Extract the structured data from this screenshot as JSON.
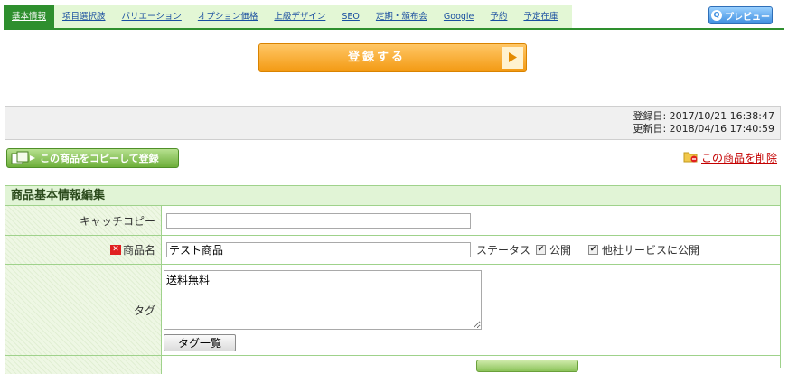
{
  "tabs": [
    {
      "label": "基本情報",
      "active": true
    },
    {
      "label": "項目選択肢",
      "active": false
    },
    {
      "label": "バリエーション",
      "active": false
    },
    {
      "label": "オプション価格",
      "active": false
    },
    {
      "label": "上級デザイン",
      "active": false
    },
    {
      "label": "SEO",
      "active": false
    },
    {
      "label": "定期・頒布会",
      "active": false
    },
    {
      "label": "Google",
      "active": false
    },
    {
      "label": "予約",
      "active": false
    },
    {
      "label": "予定在庫",
      "active": false
    }
  ],
  "preview_label": "プレビュー",
  "register_label": "登録する",
  "dates": {
    "registered": "登録日: 2017/10/21 16:38:47",
    "updated": "更新日: 2018/04/16 17:40:59"
  },
  "copy_label": "この商品をコピーして登録",
  "delete_label": "この商品を削除",
  "section_title": "商品基本情報編集",
  "form": {
    "catchcopy_label": "キャッチコピー",
    "catchcopy_value": "",
    "name_label": "商品名",
    "name_value": "テスト商品",
    "status_label": "ステータス",
    "public_label": "公開",
    "public_checked": true,
    "other_service_label": "他社サービスに公開",
    "other_service_checked": true,
    "tag_label": "タグ",
    "tag_value": "送料無料",
    "tag_list_label": "タグ一覧"
  },
  "colors": {
    "tab_active": "#2e8f2e",
    "tab_bar": "#e3f7d5",
    "register": "#f39a13",
    "delete_link": "#c40000",
    "section_border": "#9fd28b"
  }
}
